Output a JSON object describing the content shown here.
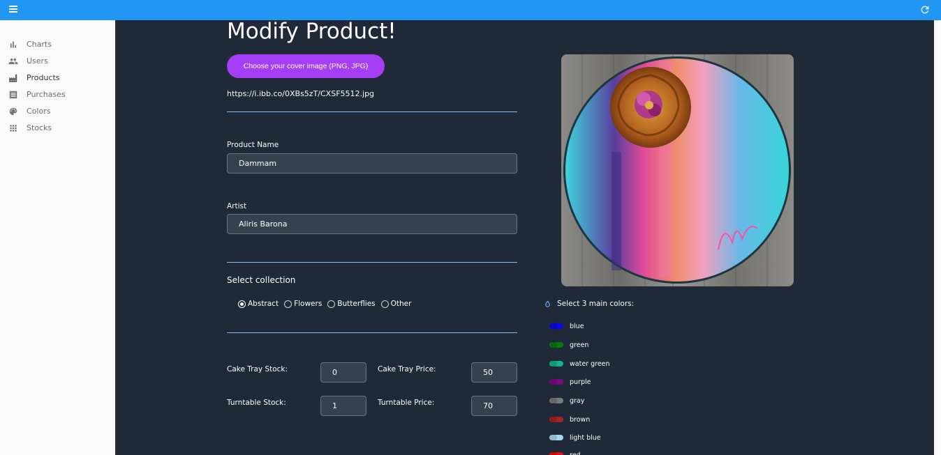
{
  "topbar": {
    "menu_icon": "hamburger-menu-icon",
    "refresh_icon": "refresh-icon",
    "color": "#2196f3"
  },
  "sidebar": {
    "items": [
      {
        "label": "Charts",
        "icon": "bar-chart-icon"
      },
      {
        "label": "Users",
        "icon": "users-icon"
      },
      {
        "label": "Products",
        "icon": "factory-icon"
      },
      {
        "label": "Purchases",
        "icon": "list-icon"
      },
      {
        "label": "Colors",
        "icon": "palette-icon"
      },
      {
        "label": "Stocks",
        "icon": "grid-icon"
      }
    ]
  },
  "form": {
    "title": "Modify Product!",
    "cover_button": "Choose your cover image (PNG, JPG)",
    "cover_url": "https://i.ibb.co/0XBs5zT/CXSF5512.jpg",
    "product_name_label": "Product Name",
    "product_name_value": "Dammam",
    "artist_label": "Artist",
    "artist_value": "Aliris Barona",
    "collection_title": "Select collection",
    "collections": [
      {
        "label": "Abstract",
        "checked": true
      },
      {
        "label": "Flowers",
        "checked": false
      },
      {
        "label": "Butterflies",
        "checked": false
      },
      {
        "label": "Other",
        "checked": false
      }
    ],
    "cake_tray_stock_label": "Cake Tray Stock:",
    "cake_tray_stock_value": "0",
    "cake_tray_price_label": "Cake Tray Price:",
    "cake_tray_price_value": "50",
    "turntable_stock_label": "Turntable Stock:",
    "turntable_stock_value": "1",
    "turntable_price_label": "Turntable Price:",
    "turntable_price_value": "70"
  },
  "colors_panel": {
    "header": "Select 3 main colors:",
    "header_icon": "drop-icon",
    "options": [
      {
        "label": "blue",
        "color": "#0a0ae6"
      },
      {
        "label": "green",
        "color": "#0a7a0a"
      },
      {
        "label": "water green",
        "color": "#10b58a"
      },
      {
        "label": "purple",
        "color": "#7a0a82"
      },
      {
        "label": "gray",
        "color": "#7a7a7a"
      },
      {
        "label": "brown",
        "color": "#a52424"
      },
      {
        "label": "light blue",
        "color": "#a8d8ea"
      },
      {
        "label": "red",
        "color": "#e61010"
      }
    ]
  }
}
